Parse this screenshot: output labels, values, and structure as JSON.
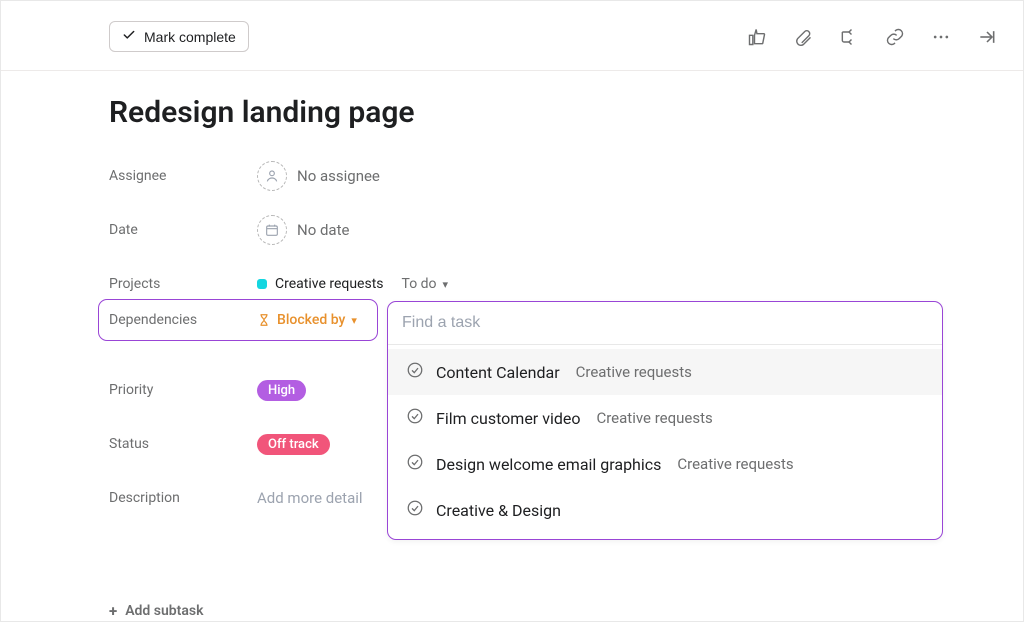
{
  "header": {
    "mark_complete_label": "Mark complete"
  },
  "task": {
    "title": "Redesign landing page"
  },
  "fields": {
    "assignee": {
      "label": "Assignee",
      "value": "No assignee"
    },
    "date": {
      "label": "Date",
      "value": "No date"
    },
    "projects": {
      "label": "Projects",
      "project_name": "Creative requests",
      "status_label": "To do"
    },
    "dependencies": {
      "label": "Dependencies",
      "blocked_by_label": "Blocked by"
    },
    "priority": {
      "label": "Priority",
      "value": "High"
    },
    "status": {
      "label": "Status",
      "value": "Off track"
    },
    "description": {
      "label": "Description",
      "placeholder": "Add more detail"
    }
  },
  "dependency_picker": {
    "search_placeholder": "Find a task",
    "items": [
      {
        "title": "Content Calendar",
        "project": "Creative requests",
        "hover": true
      },
      {
        "title": "Film customer video",
        "project": "Creative requests",
        "hover": false
      },
      {
        "title": "Design welcome email graphics",
        "project": "Creative requests",
        "hover": false
      },
      {
        "title": "Creative & Design",
        "project": "",
        "hover": false
      }
    ]
  },
  "subtasks": {
    "add_label": "Add subtask"
  },
  "colors": {
    "accent_purple": "#9945d6",
    "project_dot": "#14d6e0",
    "blocked_orange": "#e8912d",
    "priority_high": "#b35ee2",
    "status_offtrack": "#f1557a"
  }
}
